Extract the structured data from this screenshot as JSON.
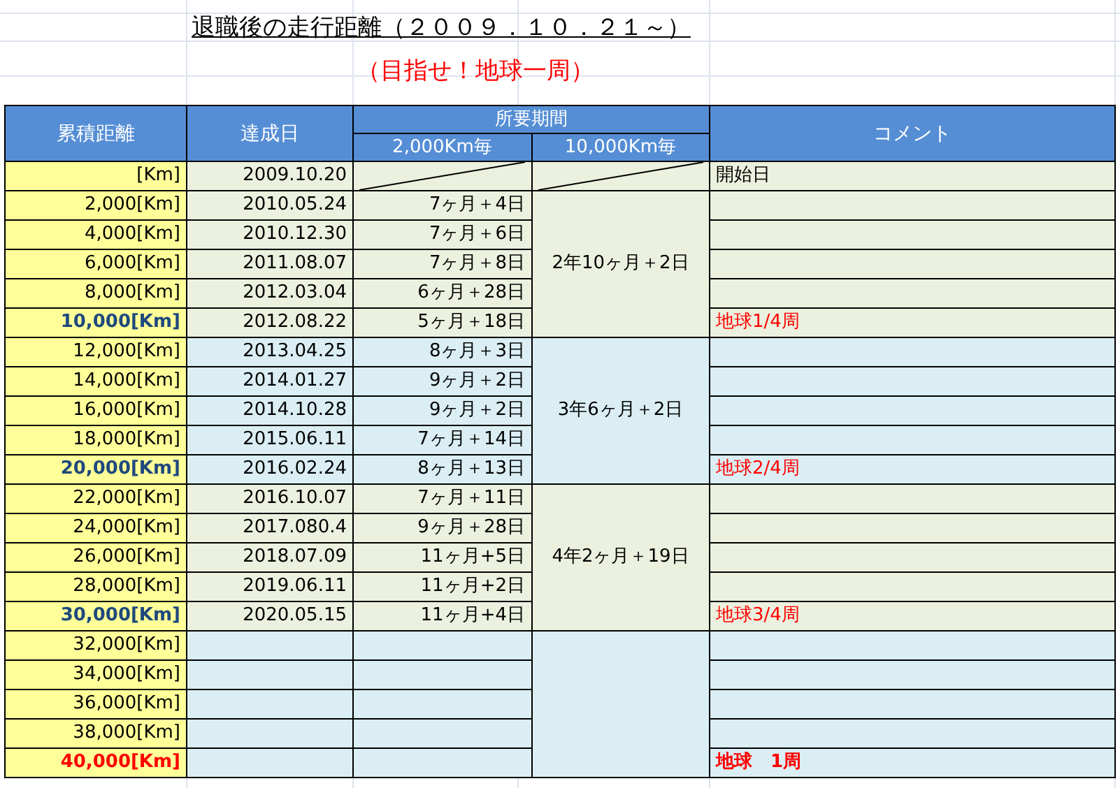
{
  "title": "退職後の走行距離（２００９．１０．２１～）",
  "subtitle": "（目指せ！地球一周）",
  "table": {
    "columns": {
      "distance": "累積距離",
      "date": "達成日",
      "period": "所要期間",
      "period_2000": "2,000Km毎",
      "period_10000": "10,000Km毎",
      "comment": "コメント"
    },
    "groups": [
      {
        "kind": "start",
        "color": "#ebf1de",
        "rows": [
          {
            "kind": "normal",
            "distance": "[Km]",
            "date": "2009.10.20",
            "comment": "開始日"
          }
        ]
      },
      {
        "kind": "span",
        "color": "#ebf1de",
        "period_10000": "2年10ヶ月＋2日",
        "rows": [
          {
            "kind": "normal",
            "distance": "2,000[Km]",
            "date": "2010.05.24",
            "period_2000": "7ヶ月＋4日"
          },
          {
            "kind": "normal",
            "distance": "4,000[Km]",
            "date": "2010.12.30",
            "period_2000": "7ヶ月＋6日"
          },
          {
            "kind": "normal",
            "distance": "6,000[Km]",
            "date": "2011.08.07",
            "period_2000": "7ヶ月＋8日"
          },
          {
            "kind": "normal",
            "distance": "8,000[Km]",
            "date": "2012.03.04",
            "period_2000": "6ヶ月＋28日"
          },
          {
            "kind": "milestone",
            "distance": "10,000[Km]",
            "date": "2012.08.22",
            "period_2000": "5ヶ月＋18日",
            "comment": "地球1/4周"
          }
        ]
      },
      {
        "kind": "span",
        "color": "#daeef3",
        "period_10000": "3年6ヶ月＋2日",
        "rows": [
          {
            "kind": "normal",
            "distance": "12,000[Km]",
            "date": "2013.04.25",
            "period_2000": "8ヶ月＋3日"
          },
          {
            "kind": "normal",
            "distance": "14,000[Km]",
            "date": "2014.01.27",
            "period_2000": "9ヶ月＋2日"
          },
          {
            "kind": "normal",
            "distance": "16,000[Km]",
            "date": "2014.10.28",
            "period_2000": "9ヶ月＋2日"
          },
          {
            "kind": "normal",
            "distance": "18,000[Km]",
            "date": "2015.06.11",
            "period_2000": "7ヶ月＋14日"
          },
          {
            "kind": "milestone",
            "distance": "20,000[Km]",
            "date": "2016.02.24",
            "period_2000": "8ヶ月＋13日",
            "comment": "地球2/4周"
          }
        ]
      },
      {
        "kind": "span",
        "color": "#ebf1de",
        "period_10000": "4年2ヶ月＋19日",
        "rows": [
          {
            "kind": "normal",
            "distance": "22,000[Km]",
            "date": "2016.10.07",
            "period_2000": "7ヶ月＋11日"
          },
          {
            "kind": "normal",
            "distance": "24,000[Km]",
            "date": "2017.080.4",
            "period_2000": "9ヶ月＋28日"
          },
          {
            "kind": "normal",
            "distance": "26,000[Km]",
            "date": "2018.07.09",
            "period_2000": "11ヶ月+5日"
          },
          {
            "kind": "normal",
            "distance": "28,000[Km]",
            "date": "2019.06.11",
            "period_2000": "11ヶ月+2日"
          },
          {
            "kind": "milestone",
            "distance": "30,000[Km]",
            "date": "2020.05.15",
            "period_2000": "11ヶ月+4日",
            "comment": "地球3/4周"
          }
        ]
      },
      {
        "kind": "span",
        "color": "#daeef3",
        "rows": [
          {
            "kind": "normal",
            "distance": "32,000[Km]"
          },
          {
            "kind": "normal",
            "distance": "34,000[Km]"
          },
          {
            "kind": "normal",
            "distance": "36,000[Km]"
          },
          {
            "kind": "normal",
            "distance": "38,000[Km]"
          },
          {
            "kind": "goal",
            "distance": "40,000[Km]",
            "comment": "地球　1周"
          }
        ]
      }
    ]
  }
}
